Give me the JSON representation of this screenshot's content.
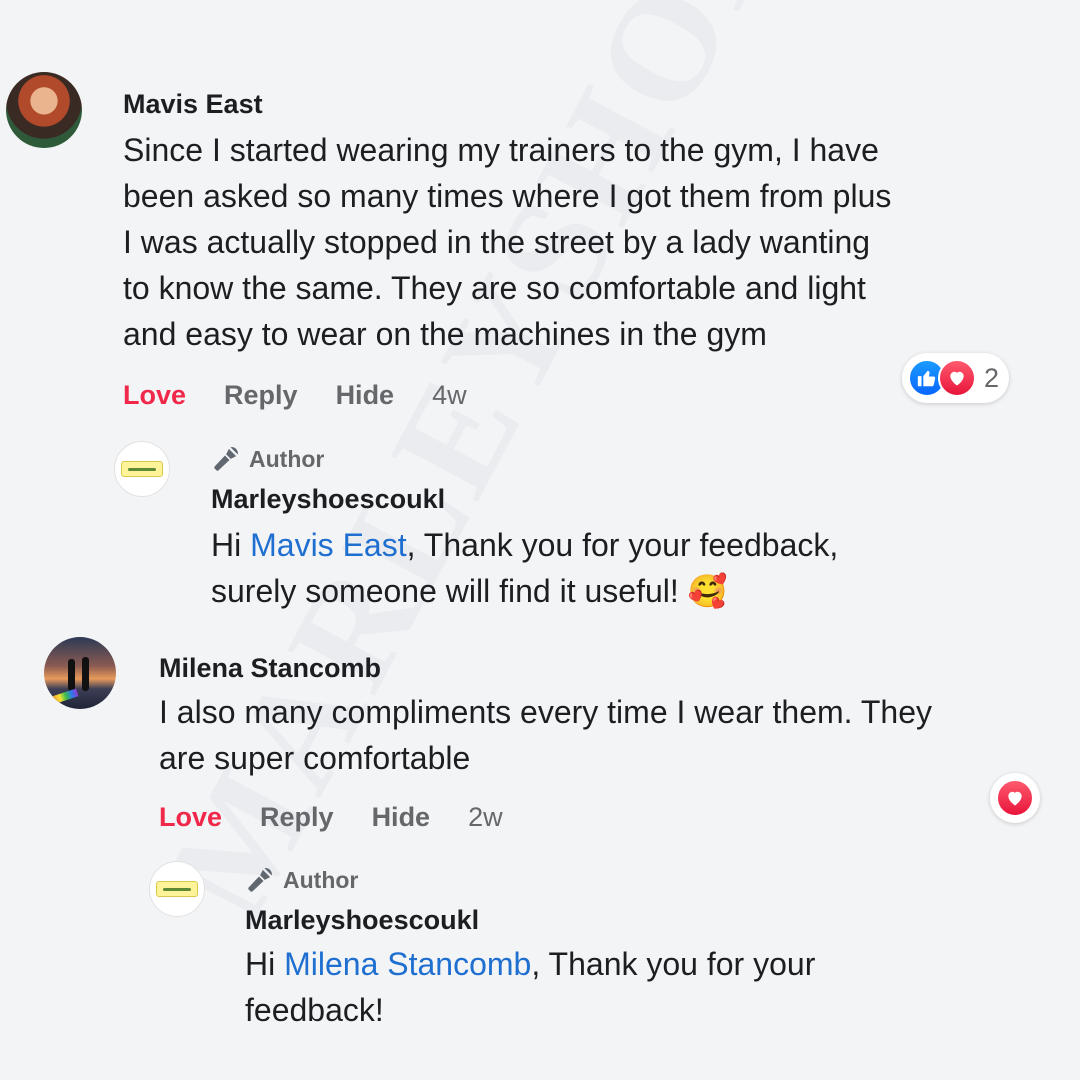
{
  "comments": [
    {
      "author": "Mavis East",
      "text_lines": [
        "Since I started wearing my trainers to the gym, I have",
        "been asked so many times where I got them from plus",
        "I was actually stopped in the street by a lady wanting",
        "to know the same. They are so comfortable and light",
        "and easy to wear on the machines in the gym"
      ],
      "actions": {
        "love": "Love",
        "reply": "Reply",
        "hide": "Hide",
        "time": "4w"
      },
      "reactions": {
        "count": "2",
        "icons": [
          "like-icon",
          "love-icon"
        ]
      },
      "reply": {
        "badge": "Author",
        "author": "Marleyshoescoukl",
        "greeting": "Hi ",
        "mention": "Mavis East",
        "line1_rest": ", Thank you for your feedback,",
        "line2": "surely someone will find it useful! 🥰"
      }
    },
    {
      "author": "Milena Stancomb",
      "text_lines": [
        "I also many compliments every time I wear them. They",
        "are super comfortable"
      ],
      "actions": {
        "love": "Love",
        "reply": "Reply",
        "hide": "Hide",
        "time": "2w"
      },
      "reactions": {
        "icons": [
          "love-icon"
        ]
      },
      "reply": {
        "badge": "Author",
        "author": "Marleyshoescoukl",
        "greeting": "Hi ",
        "mention": "Milena Stancomb",
        "line1_rest": ", Thank you for your",
        "line2": "feedback!"
      }
    }
  ],
  "colors": {
    "background": "#f3f4f6",
    "love": "#f0284a",
    "link": "#1f6fd1",
    "secondary": "#65676b"
  }
}
